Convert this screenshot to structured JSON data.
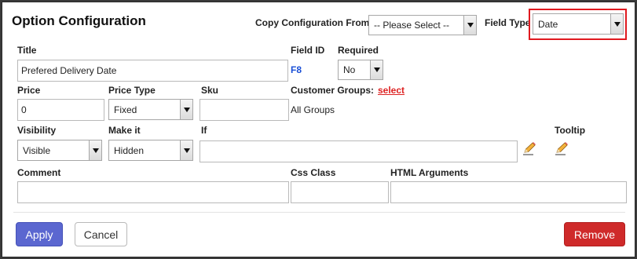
{
  "header": {
    "title": "Option Configuration",
    "copy_label": "Copy Configuration From:",
    "copy_value": "-- Please Select --",
    "field_type_label": "Field Type",
    "field_type_value": "Date"
  },
  "row1": {
    "title_label": "Title",
    "title_value": "Prefered Delivery Date",
    "field_id_label": "Field ID",
    "field_id_value": "F8",
    "required_label": "Required",
    "required_value": "No"
  },
  "row2": {
    "price_label": "Price",
    "price_value": "0",
    "price_type_label": "Price Type",
    "price_type_value": "Fixed",
    "sku_label": "Sku",
    "sku_value": "",
    "customer_groups_label": "Customer Groups:",
    "customer_groups_link": "select",
    "customer_groups_value": "All Groups"
  },
  "row3": {
    "visibility_label": "Visibility",
    "visibility_value": "Visible",
    "make_it_label": "Make it",
    "make_it_value": "Hidden",
    "if_label": "If",
    "if_value": "",
    "tooltip_label": "Tooltip"
  },
  "row4": {
    "comment_label": "Comment",
    "comment_value": "",
    "css_class_label": "Css Class",
    "css_class_value": "",
    "html_args_label": "HTML Arguments",
    "html_args_value": ""
  },
  "footer": {
    "apply_label": "Apply",
    "cancel_label": "Cancel",
    "remove_label": "Remove"
  },
  "icons": {
    "pencil_1": "pencil-icon",
    "pencil_2": "pencil-icon"
  },
  "colors": {
    "apply": "#5b67d0",
    "remove": "#cf2a2a",
    "field_type_highlight": "#e0191f",
    "field_id": "#1a4fd6",
    "link": "#dd2222"
  }
}
